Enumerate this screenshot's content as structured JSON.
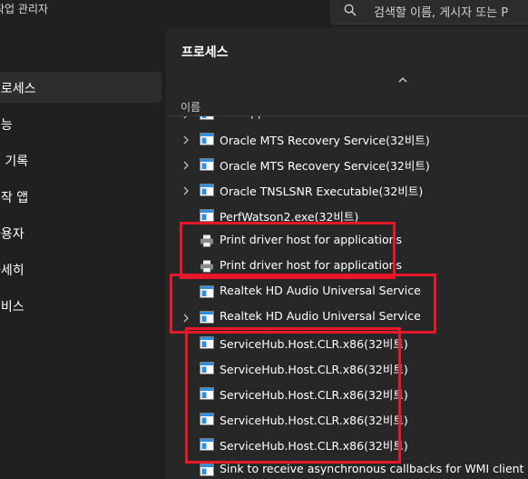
{
  "app": {
    "title": "작업 관리자"
  },
  "search": {
    "placeholder": "검색할 이름, 게시자 또는 P"
  },
  "sidebar": {
    "items": [
      {
        "label": "프로세스",
        "active": true
      },
      {
        "label": "성능"
      },
      {
        "label": "앱 기록"
      },
      {
        "label": "시작 앱"
      },
      {
        "label": "사용자"
      },
      {
        "label": "자세히"
      },
      {
        "label": "서비스"
      }
    ]
  },
  "main": {
    "title": "프로세스",
    "column_header": "이름"
  },
  "processes": [
    {
      "name": "OneApp.IGCC.WinService.exe",
      "expandable": true,
      "icon": "app-window-icon"
    },
    {
      "name": "Oracle MTS Recovery Service(32비트)",
      "expandable": true,
      "icon": "app-window-icon"
    },
    {
      "name": "Oracle MTS Recovery Service(32비트)",
      "expandable": true,
      "icon": "app-window-icon"
    },
    {
      "name": "Oracle TNSLSNR Executable(32비트)",
      "expandable": true,
      "icon": "app-window-icon"
    },
    {
      "name": "PerfWatson2.exe(32비트)",
      "expandable": false,
      "icon": "app-window-icon"
    },
    {
      "name": "Print driver host for applications",
      "expandable": false,
      "icon": "printer-icon"
    },
    {
      "name": "Print driver host for applications",
      "expandable": false,
      "icon": "printer-icon"
    },
    {
      "name": "Realtek HD Audio Universal Service",
      "expandable": false,
      "icon": "app-window-icon"
    },
    {
      "name": "Realtek HD Audio Universal Service",
      "expandable": true,
      "icon": "app-window-icon"
    },
    {
      "name": "ServiceHub.Host.CLR.x86(32비트)",
      "expandable": false,
      "icon": "app-window-icon"
    },
    {
      "name": "ServiceHub.Host.CLR.x86(32비트)",
      "expandable": false,
      "icon": "app-window-icon"
    },
    {
      "name": "ServiceHub.Host.CLR.x86(32비트)",
      "expandable": false,
      "icon": "app-window-icon"
    },
    {
      "name": "ServiceHub.Host.CLR.x86(32비트)",
      "expandable": false,
      "icon": "app-window-icon"
    },
    {
      "name": "ServiceHub.Host.CLR.x86(32비트)",
      "expandable": false,
      "icon": "app-window-icon"
    },
    {
      "name": "Sink to receive asynchronous callbacks for WMI client applicatio",
      "expandable": false,
      "icon": "app-window-icon"
    }
  ],
  "colors": {
    "background": "#202020",
    "panel": "#272727",
    "highlight_box": "#e8172a",
    "icon_blue": "#2f8fe6"
  }
}
